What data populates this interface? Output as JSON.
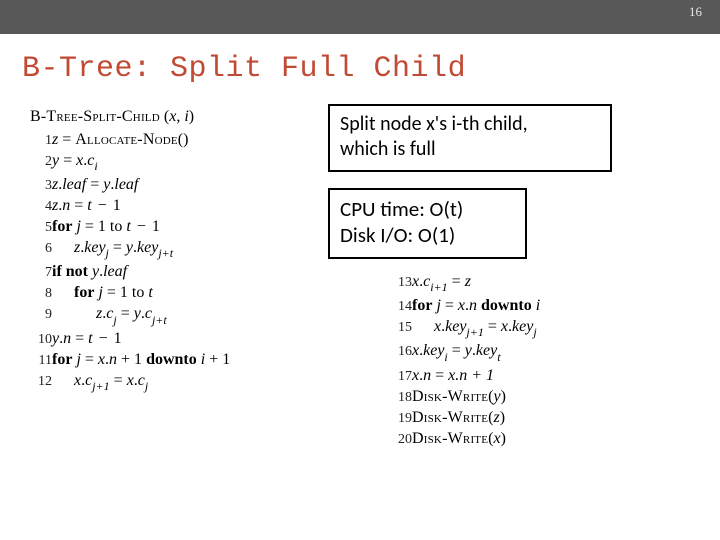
{
  "page_number": "16",
  "title": "B-Tree: Split Full Child",
  "infobox1_line1": "Split node x's i-th child,",
  "infobox1_line2": "which is full",
  "infobox2_line1": "CPU time: O(t)",
  "infobox2_line2": "Disk I/O: O(1)",
  "func": {
    "name_sc": "B-Tree-Split-Child",
    "arg1": "x",
    "arg2": "i"
  },
  "kw": {
    "for": "for",
    "if_not": "if not",
    "downto": "downto"
  },
  "call": {
    "allocate": "Allocate-Node",
    "diskwrite": "Disk-Write"
  },
  "lines_left": [
    "1",
    "2",
    "3",
    "4",
    "5",
    "6",
    "7",
    "8",
    "9",
    "10",
    "11",
    "12"
  ],
  "lines_right": [
    "13",
    "14",
    "15",
    "16",
    "17",
    "18",
    "19",
    "20"
  ],
  "sym": {
    "eq": " = ",
    "dot": ".",
    "lp": "(",
    "rp": ")",
    "comma": ", ",
    "plus1": " + 1",
    "minus1": "1",
    "to": " to "
  },
  "expr": {
    "z": "z",
    "y": "y",
    "x": "x",
    "i": "i",
    "j": "j",
    "t": "t",
    "t_minus_1": "t − 1",
    "leaf": "leaf",
    "n": "n",
    "key": "key",
    "c": "c",
    "j_plus_1": "j+1",
    "j_plus_t": "j+t",
    "i_plus_1": "i+1",
    "x_n_plus_1": "x.n + 1"
  }
}
